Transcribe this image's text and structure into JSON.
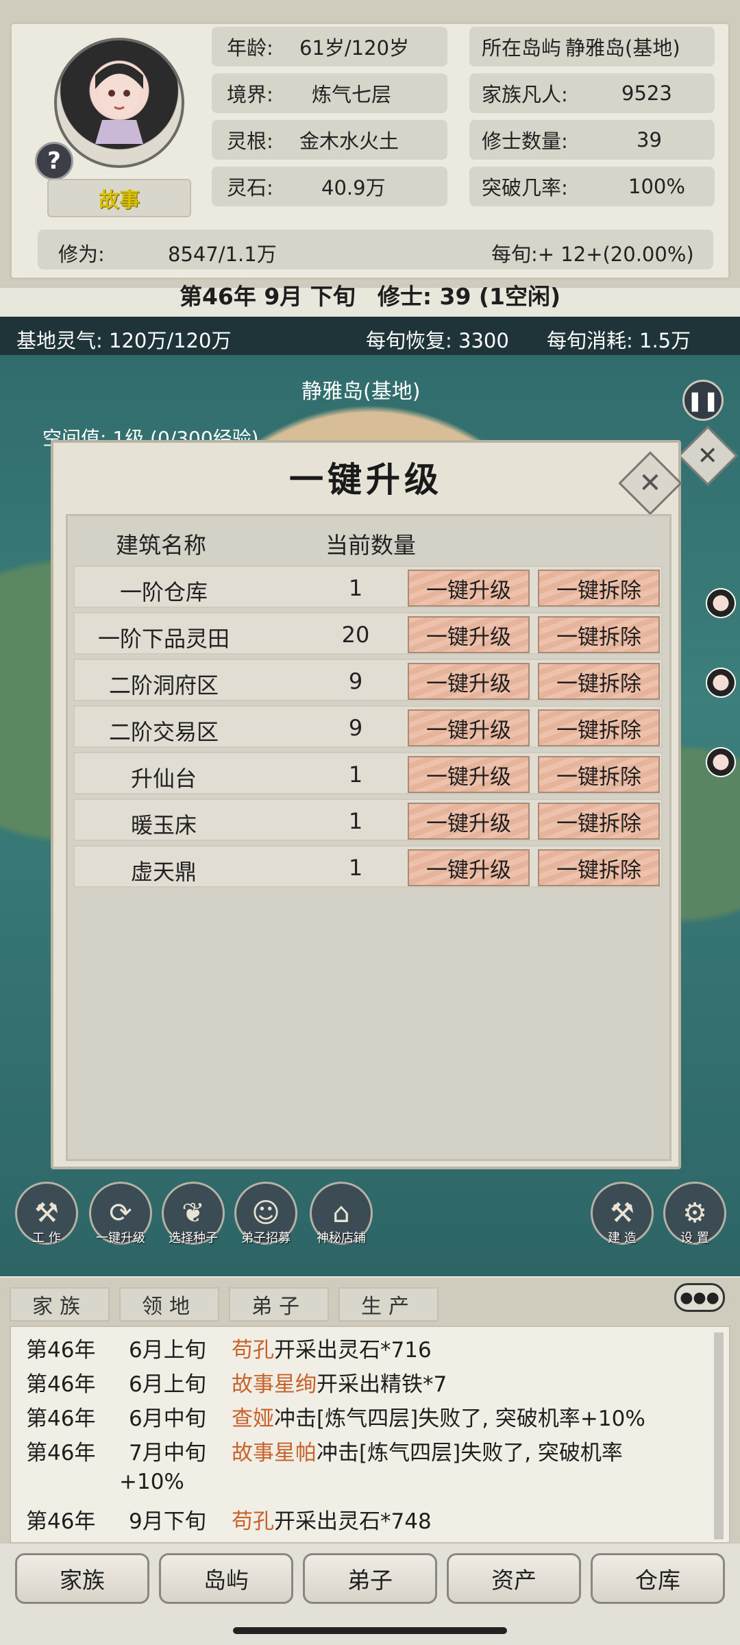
{
  "profile": {
    "story_button": "故事",
    "help_icon": "question-icon",
    "stats": {
      "age_label": "年龄:",
      "age_value": "61岁/120岁",
      "island_label": "所在岛屿",
      "island_value": "静雅岛(基地)",
      "realm_label": "境界:",
      "realm_value": "炼气七层",
      "family_label": "家族凡人:",
      "family_value": "9523",
      "root_label": "灵根:",
      "root_value": "金木水火土",
      "cultivators_label": "修士数量:",
      "cultivators_value": "39",
      "stones_label": "灵石:",
      "stones_value": "40.9万",
      "breakthrough_label": "突破几率:",
      "breakthrough_value": "100%"
    },
    "cultivation_label": "修为:",
    "cultivation_value": "8547/1.1万",
    "per_period": "每旬:+ 12+(20.00%)"
  },
  "date_line": {
    "date": "第46年 9月 下旬",
    "cultivators": "修士: 39 (1空闲)"
  },
  "map": {
    "spirit_qi": "基地灵气: 120万/120万",
    "recovery": "每旬恢复: 3300",
    "consumption": "每旬消耗: 1.5万",
    "island_name": "静雅岛(基地)",
    "space_exp": "空间值: 1级 (0/300经验)",
    "tools": [
      "工 作",
      "一键升级",
      "选择种子",
      "弟子招募",
      "神秘店铺",
      "建 造",
      "设 置"
    ]
  },
  "modal": {
    "title": "一键升级",
    "col_name": "建筑名称",
    "col_count": "当前数量",
    "upgrade_label": "一键升级",
    "demolish_label": "一键拆除",
    "rows": [
      {
        "name": "一阶仓库",
        "count": "1"
      },
      {
        "name": "一阶下品灵田",
        "count": "20"
      },
      {
        "name": "二阶洞府区",
        "count": "9"
      },
      {
        "name": "二阶交易区",
        "count": "9"
      },
      {
        "name": "升仙台",
        "count": "1"
      },
      {
        "name": "暖玉床",
        "count": "1"
      },
      {
        "name": "虚天鼎",
        "count": "1"
      }
    ]
  },
  "log": {
    "tabs": [
      "家族",
      "领地",
      "弟子",
      "生产"
    ],
    "entries": [
      {
        "year": "第46年",
        "month": "6月上旬",
        "who": "苟孔",
        "text": "开采出灵石*716"
      },
      {
        "year": "第46年",
        "month": "6月上旬",
        "who": "故事星绚",
        "text": "开采出精铁*7"
      },
      {
        "year": "第46年",
        "month": "6月中旬",
        "who": "查娅",
        "text": "冲击[炼气四层]失败了, 突破机率+10%"
      },
      {
        "year": "第46年",
        "month": "7月中旬",
        "who": "故事星帕",
        "text": "冲击[炼气四层]失败了, 突破机率"
      },
      {
        "year": "",
        "month": "",
        "who": "",
        "text": "+10%"
      },
      {
        "year": "第46年",
        "month": "9月下旬",
        "who": "苟孔",
        "text": "开采出灵石*748"
      }
    ]
  },
  "nav": [
    "家族",
    "岛屿",
    "弟子",
    "资产",
    "仓库"
  ],
  "colors": {
    "accent": "#c8622a",
    "button": "#e6b39b",
    "panel": "#ece9df"
  }
}
